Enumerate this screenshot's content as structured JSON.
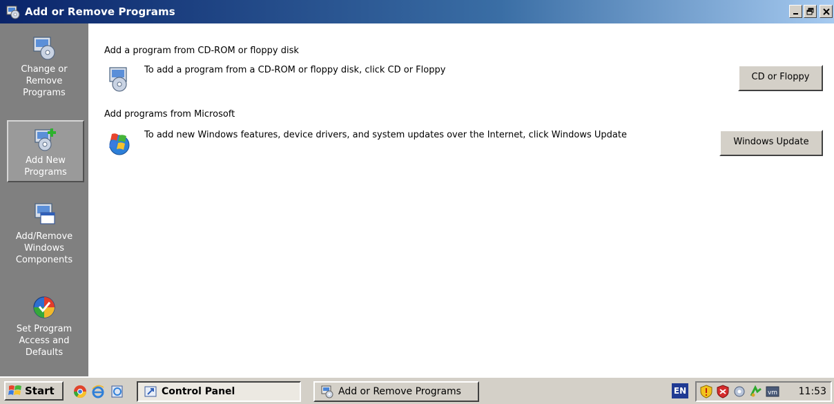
{
  "window": {
    "title": "Add or Remove Programs",
    "icon": "programs-icon",
    "controls": {
      "minimize": "_",
      "maximize": "🗗",
      "close": "✕"
    }
  },
  "sidebar": {
    "items": [
      {
        "label_lines": [
          "Change or",
          "Remove",
          "Programs"
        ],
        "icon": "change-remove-icon",
        "selected": false
      },
      {
        "label_lines": [
          "Add New",
          "Programs"
        ],
        "icon": "add-new-icon",
        "selected": true
      },
      {
        "label_lines": [
          "Add/Remove",
          "Windows",
          "Components"
        ],
        "icon": "windows-components-icon",
        "selected": false
      },
      {
        "label_lines": [
          "Set Program",
          "Access and",
          "Defaults"
        ],
        "icon": "program-access-icon",
        "selected": false
      }
    ]
  },
  "main": {
    "cd_section": {
      "heading": "Add a program from CD-ROM or floppy disk",
      "description": "To add a program from a CD-ROM or floppy disk, click CD or Floppy",
      "button": "CD or Floppy"
    },
    "ms_section": {
      "heading": "Add programs from Microsoft",
      "description": "To add new Windows features, device drivers, and system updates over the Internet, click Windows Update",
      "button": "Windows Update"
    }
  },
  "taskbar": {
    "start": "Start",
    "quick_launch": [
      "chrome-icon",
      "internet-explorer-icon",
      "explorer-icon"
    ],
    "tasks": [
      {
        "label": "Control Panel",
        "active": true
      },
      {
        "label": "Add or Remove Programs",
        "active": false
      }
    ],
    "language": "EN",
    "tray_icons": [
      "security-shield-icon",
      "antivirus-icon",
      "network-icon",
      "connection-icon",
      "vmware-icon"
    ],
    "clock": "11:53"
  }
}
